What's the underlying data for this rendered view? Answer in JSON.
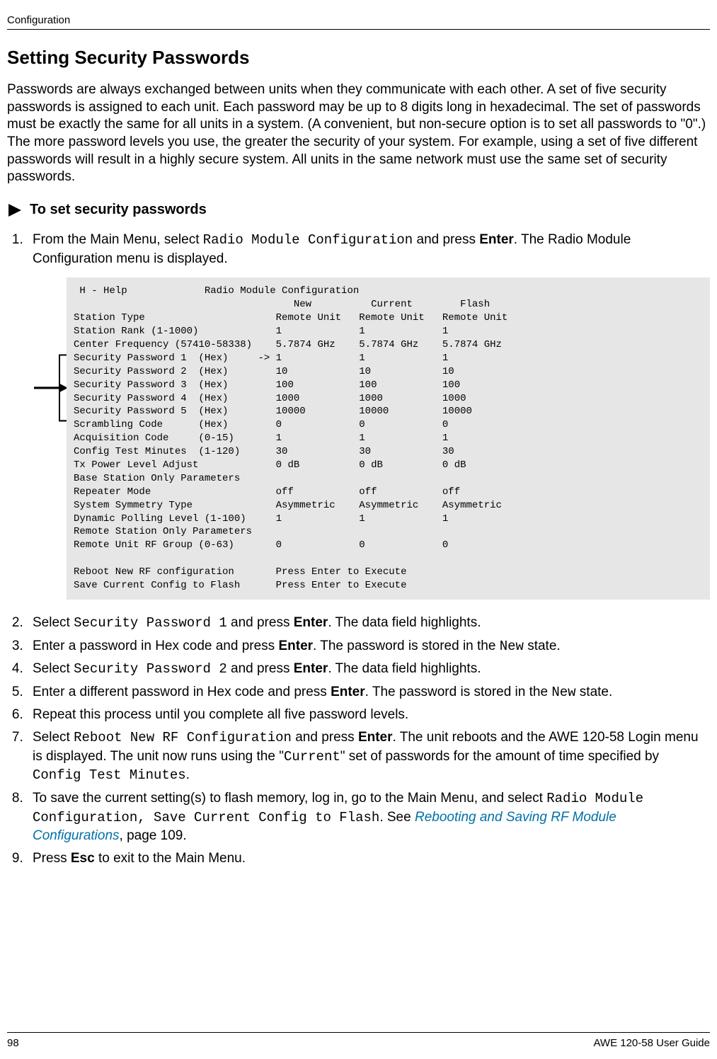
{
  "header": {
    "section": "Configuration"
  },
  "title": "Setting Security Passwords",
  "intro": "Passwords are always exchanged between units when they communicate with each other. A set of five security passwords is assigned to each unit. Each password may be up to 8 digits long in hexadecimal. The set of passwords must be exactly the same for all units in a system. (A convenient, but non-secure option is to set all passwords to \"0\".) The more password levels you use, the greater the security of your system. For example, using a set of five different passwords will result in a highly secure system. All units in the same network must use the same set of security passwords.",
  "procedure_title": "To set security passwords",
  "steps": {
    "s1a": "From the Main Menu, select ",
    "s1_code": "Radio Module Configuration",
    "s1b": " and press ",
    "s1_bold": "Enter",
    "s1c": ". The Radio Module Configuration menu is displayed.",
    "s2a": "Select ",
    "s2_code": "Security Password 1",
    "s2b": " and press ",
    "s2_bold": "Enter",
    "s2c": ". The data field highlights.",
    "s3a": "Enter a password in Hex code and press ",
    "s3_bold": "Enter",
    "s3b": ". The password is stored in the ",
    "s3_code": "New",
    "s3c": " state.",
    "s4a": "Select ",
    "s4_code": "Security Password 2",
    "s4b": " and press ",
    "s4_bold": "Enter",
    "s4c": ". The data field highlights.",
    "s5a": "Enter a different password in Hex code and press ",
    "s5_bold": "Enter",
    "s5b": ". The password is stored in the ",
    "s5_code": "New",
    "s5c": " state.",
    "s6": "Repeat this process until you complete all five password levels.",
    "s7a": "Select ",
    "s7_code1": "Reboot New RF Configuration",
    "s7b": " and press ",
    "s7_bold": "Enter",
    "s7c": ". The unit reboots and the AWE 120-58 Login menu is displayed. The unit now runs using the \"",
    "s7_code2": "Current",
    "s7d": "\" set of passwords for the amount of time specified by ",
    "s7_code3": "Config Test Minutes",
    "s7e": ".",
    "s8a": "To save the current setting(s) to flash memory, log in, go to the Main Menu, and select ",
    "s8_code1": "Radio Module Configuration",
    "s8_sep": ", ",
    "s8_code2": "Save Current Config to Flash",
    "s8b": ". See ",
    "s8_link": "Rebooting and Saving RF Module Configurations",
    "s8c": ", page 109.",
    "s9a": "Press ",
    "s9_bold": "Esc",
    "s9b": " to exit to the Main Menu."
  },
  "terminal": " H - Help             Radio Module Configuration\n                                     New          Current        Flash\nStation Type                      Remote Unit   Remote Unit   Remote Unit\nStation Rank (1-1000)             1             1             1\nCenter Frequency (57410-58338)    5.7874 GHz    5.7874 GHz    5.7874 GHz\nSecurity Password 1  (Hex)     -> 1             1             1\nSecurity Password 2  (Hex)        10            10            10\nSecurity Password 3  (Hex)        100           100           100\nSecurity Password 4  (Hex)        1000          1000          1000\nSecurity Password 5  (Hex)        10000         10000         10000\nScrambling Code      (Hex)        0             0             0\nAcquisition Code     (0-15)       1             1             1\nConfig Test Minutes  (1-120)      30            30            30\nTx Power Level Adjust             0 dB          0 dB          0 dB\nBase Station Only Parameters\nRepeater Mode                     off           off           off\nSystem Symmetry Type              Asymmetric    Asymmetric    Asymmetric\nDynamic Polling Level (1-100)     1             1             1\nRemote Station Only Parameters\nRemote Unit RF Group (0-63)       0             0             0\n\nReboot New RF configuration       Press Enter to Execute\nSave Current Config to Flash      Press Enter to Execute",
  "footer": {
    "page": "98",
    "guide": "AWE 120-58 User Guide"
  }
}
